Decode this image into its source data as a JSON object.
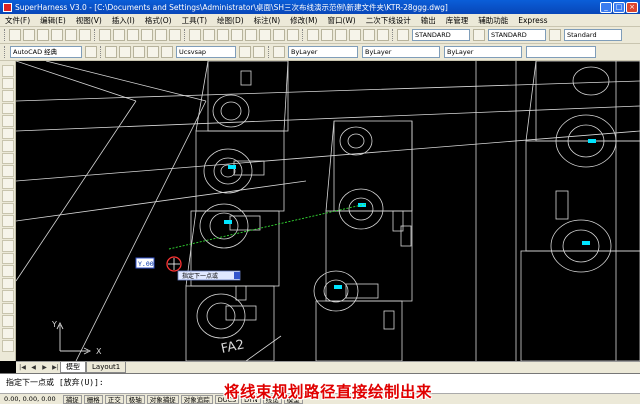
{
  "window": {
    "app_title": "SuperHarness V3.0 - [C:\\Documents and Settings\\Administrator\\桌面\\SH三次布线演示范例\\新建文件夹\\KTR-28ggg.dwg]",
    "minimize": "_",
    "maximize": "□",
    "close": "×"
  },
  "menu": {
    "items": [
      "文件(F)",
      "编辑(E)",
      "视图(V)",
      "插入(I)",
      "格式(O)",
      "工具(T)",
      "绘图(D)",
      "标注(N)",
      "修改(M)",
      "窗口(W)",
      "二次下线设计",
      "输出",
      "库管理",
      "辅助功能",
      "Express"
    ]
  },
  "toolbar": {
    "layer_select": "AutoCAD 经典",
    "ucs_select": "Ucsvsap",
    "style1": "STANDARD",
    "style2": "STANDARD",
    "style3": "Standard",
    "bylayer1": "ByLayer",
    "bylayer2": "ByLayer",
    "bylayer3": "ByLayer"
  },
  "canvas": {
    "input_value": "Y.00",
    "tooltip": "指定下一点或",
    "label_fa2": "FA2",
    "ucs_x": "X",
    "ucs_y": "Y"
  },
  "tabs": {
    "items": [
      "模型",
      "Layout1"
    ]
  },
  "command": {
    "prompt": "指定下一点或 [放弃(U)]:",
    "coords": "0.00, 0.00, 0.00",
    "status_items": [
      "捕捉",
      "栅格",
      "正交",
      "极轴",
      "对象捕捉",
      "对象追踪",
      "DUCS",
      "DYN",
      "线宽",
      "模型"
    ]
  },
  "caption": "将线束规划路径直接绘制出来"
}
